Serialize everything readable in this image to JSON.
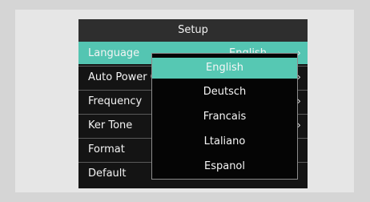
{
  "setup": {
    "title": "Setup",
    "rows": [
      {
        "label": "Language",
        "value": "English"
      },
      {
        "label": "Auto Power Off"
      },
      {
        "label": "Frequency"
      },
      {
        "label": "Ker Tone"
      },
      {
        "label": "Format"
      },
      {
        "label": "Default"
      }
    ]
  },
  "dropdown": {
    "options": [
      "English",
      "Deutsch",
      "Francais",
      "Ltaliano",
      "Espanol"
    ],
    "selected": "English"
  },
  "colors": {
    "highlight": "#54c5b2",
    "menu_background": "#141414",
    "title_bar": "#2e2e2e"
  },
  "icons": {
    "submenu_arrow": "chevron-right-icon"
  }
}
